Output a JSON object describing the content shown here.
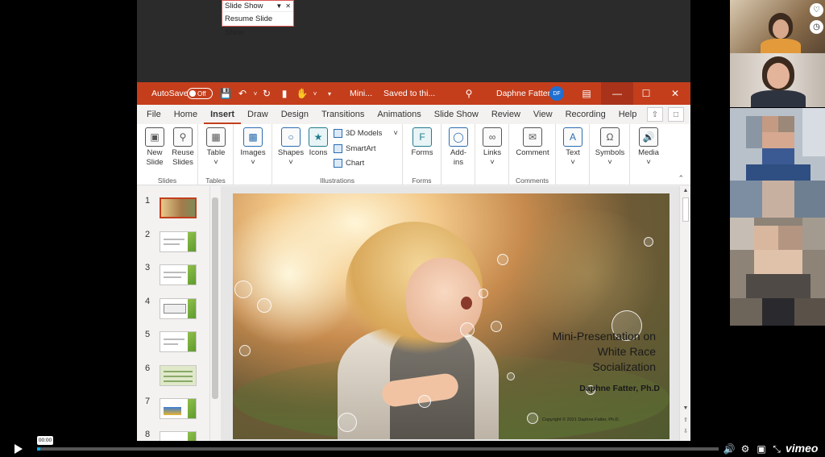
{
  "slideshow_toolbar": {
    "title": "Slide Show",
    "resume": "Resume Slide Show"
  },
  "titlebar": {
    "autosave_label": "AutoSave",
    "autosave_state": "Off",
    "file_name": "Mini...",
    "saved_status": "Saved to thi...",
    "user_name": "Daphne Fatter",
    "user_initials": "DF"
  },
  "tabs": [
    "File",
    "Home",
    "Insert",
    "Draw",
    "Design",
    "Transitions",
    "Animations",
    "Slide Show",
    "Review",
    "View",
    "Recording",
    "Help"
  ],
  "active_tab": "Insert",
  "ribbon": {
    "slides_group": "Slides",
    "new_slide": "New Slide ˅",
    "new_slide_line1": "New",
    "new_slide_line2": "Slide",
    "reuse_line1": "Reuse",
    "reuse_line2": "Slides",
    "tables_group": "Tables",
    "table": "Table",
    "images": "Images",
    "illustrations_group": "Illustrations",
    "shapes": "Shapes",
    "icons": "Icons",
    "models_3d": "3D Models",
    "smartart": "SmartArt",
    "chart": "Chart",
    "forms_group": "Forms",
    "forms": "Forms",
    "addins_line1": "Add-",
    "addins_line2": "ins",
    "links": "Links",
    "comments_group": "Comments",
    "comment": "Comment",
    "text": "Text",
    "symbols": "Symbols",
    "media": "Media"
  },
  "thumbnails": [
    "1",
    "2",
    "3",
    "4",
    "5",
    "6",
    "7",
    "8"
  ],
  "slide": {
    "title_line1": "Mini-Presentation on",
    "title_line2": "White Race",
    "title_line3": "Socialization",
    "author": "Daphne Fatter, Ph.D",
    "copyright": "Copyright © 2021 Daphne Fatter, Ph.D."
  },
  "player": {
    "time": "00:00",
    "logo": "vimeo",
    "progress": 0.005
  }
}
